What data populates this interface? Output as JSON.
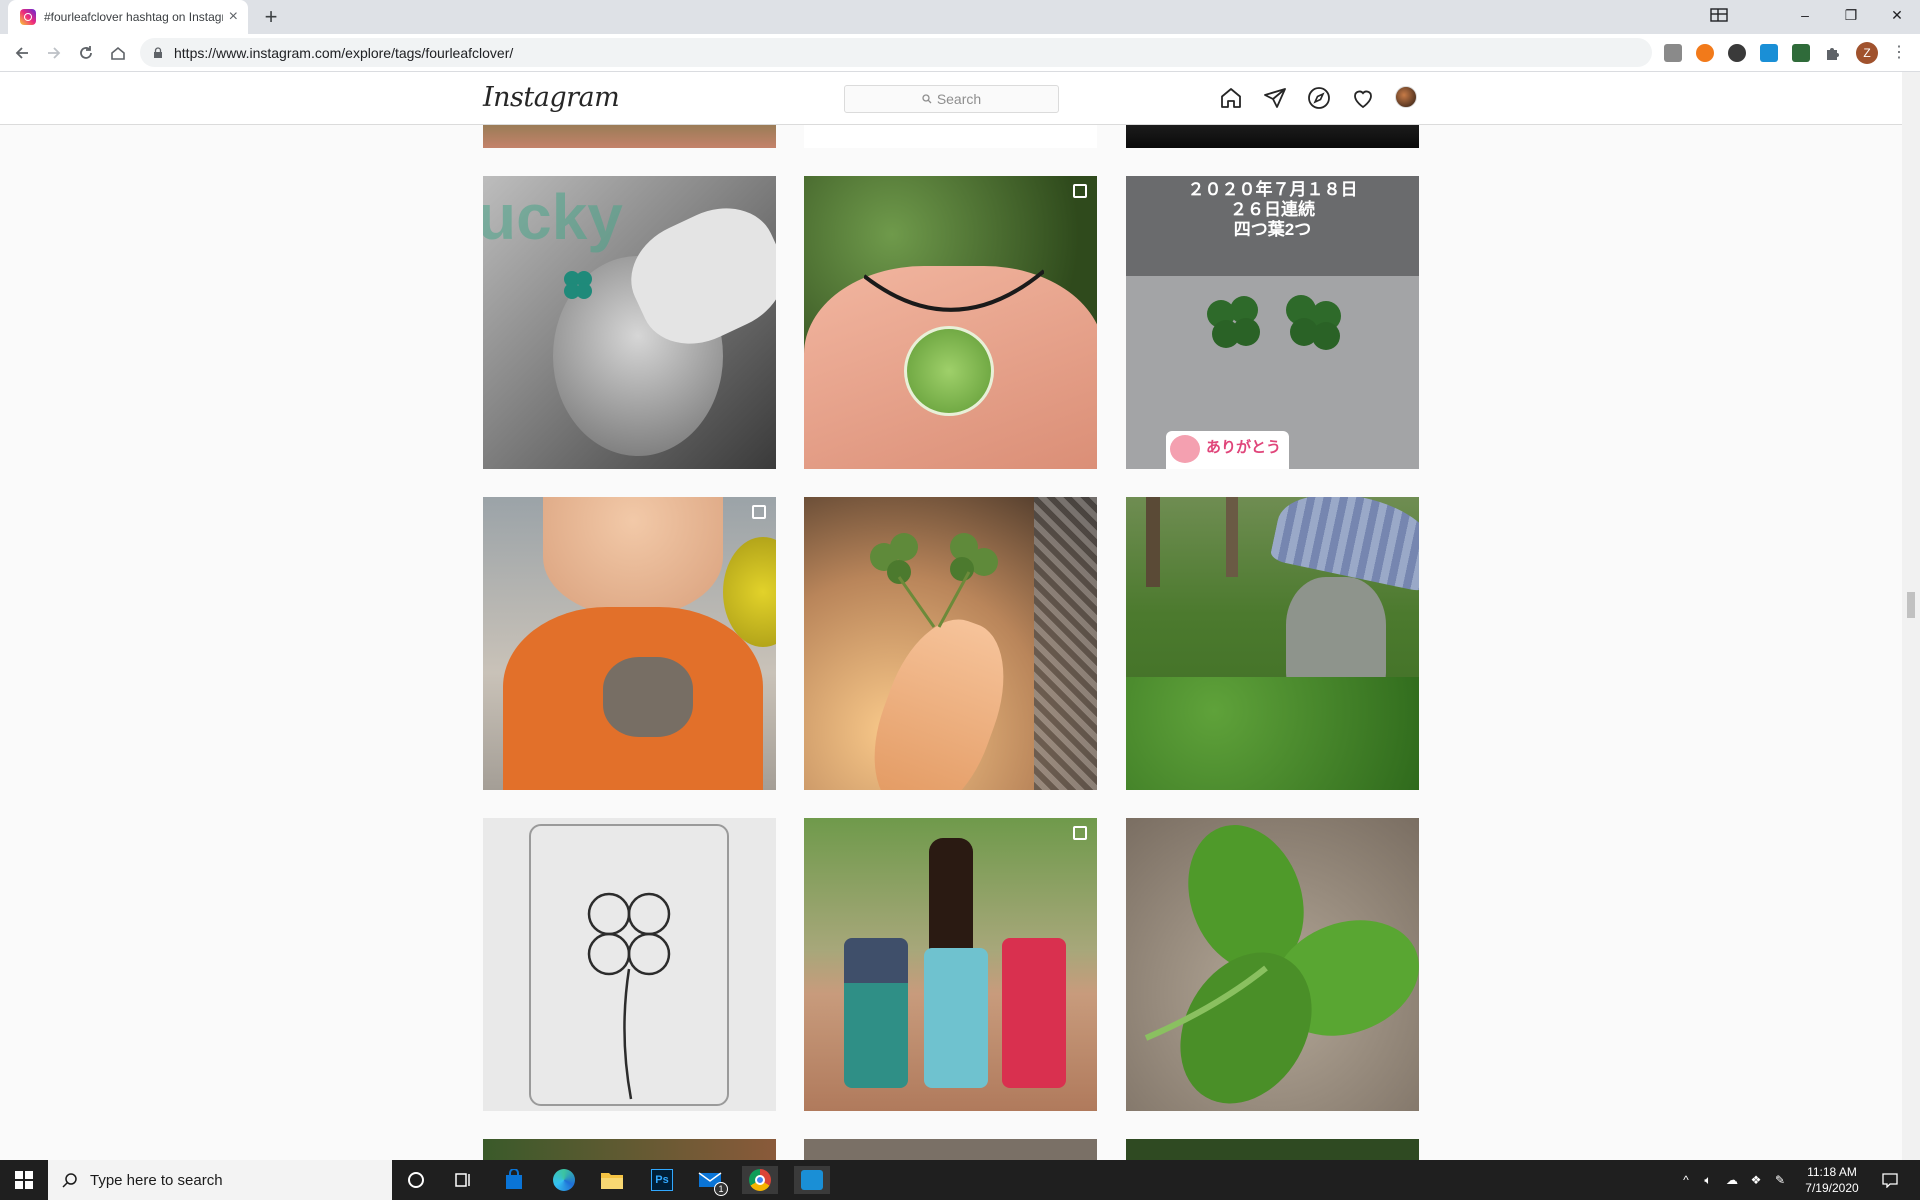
{
  "browser": {
    "tab_title": "#fourleafclover hashtag on Instagram",
    "tab_close": "×",
    "new_tab": "+",
    "url": "https://www.instagram.com/explore/tags/fourleafclover/",
    "profile_initial": "Z",
    "window_controls": {
      "minimize": "–",
      "maximize": "❐",
      "close": "✕"
    }
  },
  "instagram": {
    "logo": "Instagram",
    "search_placeholder": "Search",
    "nav_icons": [
      "home-icon",
      "direct-icon",
      "explore-icon",
      "activity-icon",
      "profile-avatar"
    ]
  },
  "grid": {
    "rows": [
      {
        "posts": [
          {
            "name": "post-man-clover-hair",
            "multi": false,
            "overlay_text": "ucky",
            "palette": [
              "#8a8a8a",
              "#2a2a2a"
            ]
          },
          {
            "name": "post-clover-pendant",
            "multi": true,
            "palette": [
              "#e9a98c",
              "#5f8a3a"
            ]
          },
          {
            "name": "post-clover-count",
            "multi": false,
            "overlay_lines": [
              "２０２０年７月１８日",
              "２６日連続",
              "四つ葉2つ"
            ],
            "sticker_text": "ありがとう",
            "palette": [
              "#9fa0a2",
              "#2f6b2a"
            ]
          }
        ]
      },
      {
        "posts": [
          {
            "name": "post-smiling-child",
            "multi": true,
            "palette": [
              "#e0732c",
              "#6b6b6b"
            ]
          },
          {
            "name": "post-hand-clover",
            "multi": false,
            "palette": [
              "#f6c08b",
              "#3c2b20"
            ]
          },
          {
            "name": "post-forest-umbrella",
            "multi": false,
            "palette": [
              "#4c7a2e",
              "#9aa9c8"
            ]
          }
        ]
      },
      {
        "posts": [
          {
            "name": "post-clover-drawing",
            "multi": false,
            "palette": [
              "#e8e8e8",
              "#2c2c2c"
            ]
          },
          {
            "name": "post-can-coolers",
            "multi": true,
            "palette": [
              "#2f8fa8",
              "#d9304f"
            ]
          },
          {
            "name": "post-big-clover-leaf",
            "multi": false,
            "palette": [
              "#4f9a2a",
              "#b4a898"
            ]
          }
        ]
      }
    ]
  },
  "taskbar": {
    "search_placeholder": "Type here to search",
    "time": "11:18 AM",
    "date": "7/19/2020",
    "mail_badge": "1"
  }
}
